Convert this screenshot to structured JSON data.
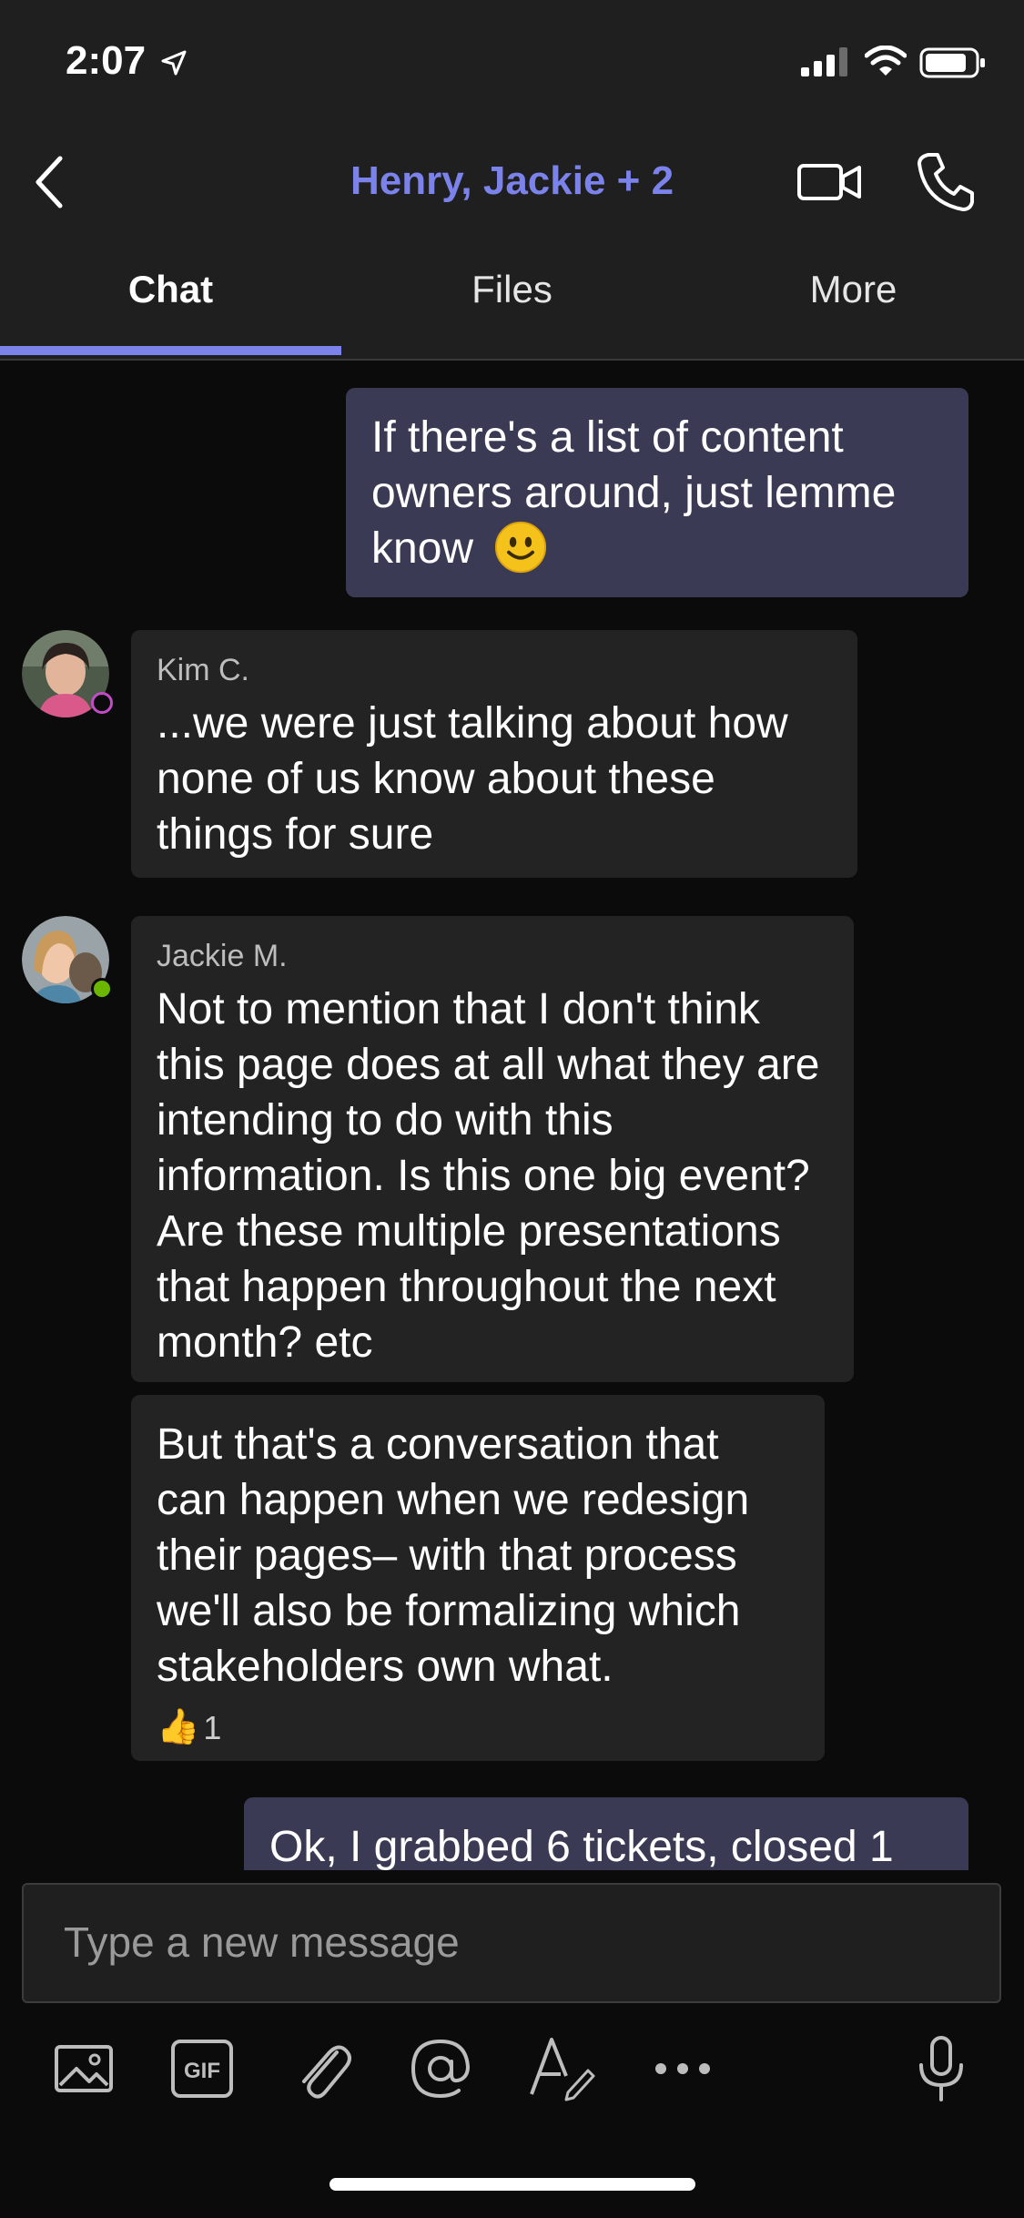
{
  "status_bar": {
    "time": "2:07",
    "icons": [
      "location-arrow-icon",
      "cellular-signal-icon",
      "wifi-icon",
      "battery-icon"
    ]
  },
  "header": {
    "title": "Henry, Jackie + 2",
    "accent_color": "#7b83eb",
    "icons": [
      "back-chevron-icon",
      "video-camera-icon",
      "phone-icon"
    ]
  },
  "tabs": [
    {
      "label": "Chat",
      "active": true
    },
    {
      "label": "Files",
      "active": false
    },
    {
      "label": "More",
      "active": false
    }
  ],
  "messages": {
    "m1": {
      "text": "If there's a list of content owners around, just lemme know",
      "emoji": "smiley-emoji-icon"
    },
    "m2": {
      "sender": "Kim C.",
      "text": "...we were just talking about how none of us know about these things for sure"
    },
    "m3": {
      "sender": "Jackie M.",
      "text": "Not to mention that I don't think this page does at all what they are intending to do with this information. Is this one big event? Are these multiple presentations that happen throughout the next month? etc"
    },
    "m4": {
      "text": "But that's a conversation that can happen when we redesign their pages– with that process we'll also be formalizing which stakeholders own what.",
      "reaction_count": "1",
      "reaction_icon": "thumbs-up-emoji-icon"
    },
    "m5": {
      "text": "Ok, I grabbed 6 tickets, closed 1"
    }
  },
  "composer": {
    "placeholder": "Type a new message",
    "tools": [
      "image-icon",
      "gif-icon",
      "attach-icon",
      "mention-icon",
      "format-icon",
      "more-icon",
      "microphone-icon"
    ]
  }
}
